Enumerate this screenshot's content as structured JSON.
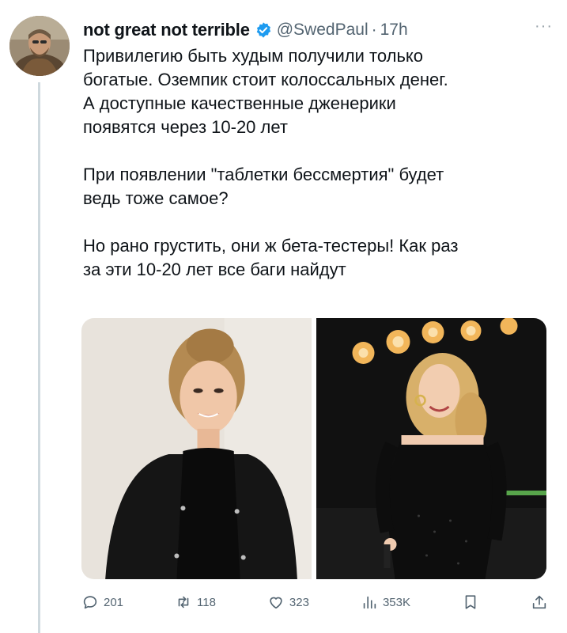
{
  "author": {
    "name": "not great not terrible",
    "handle": "@SwedPaul",
    "separator": "·",
    "time": "17h"
  },
  "more_label": "···",
  "tweet": {
    "paragraphs": [
      [
        "Привилегию быть худым получили только",
        "богатые. Оземпик стоит колоссальных денег.",
        "А доступные качественные дженерики",
        "появятся через 10-20 лет"
      ],
      [
        "При появлении \"таблетки бессмертия\" будет",
        "ведь тоже самое?"
      ],
      [
        "Но рано грустить, они ж бета-тестеры! Как раз",
        "за эти 10-20 лет все баги найдут"
      ]
    ]
  },
  "media": {
    "photos": [
      {
        "name": "photo-left-woman-black-jacket"
      },
      {
        "name": "photo-right-woman-on-stage"
      }
    ]
  },
  "actions": {
    "reply": {
      "icon": "reply-icon",
      "count": "201"
    },
    "retweet": {
      "icon": "retweet-icon",
      "count": "118"
    },
    "like": {
      "icon": "heart-icon",
      "count": "323"
    },
    "views": {
      "icon": "views-icon",
      "count": "353K"
    },
    "bookmark": {
      "icon": "bookmark-icon"
    },
    "share": {
      "icon": "share-icon"
    }
  },
  "colors": {
    "text": "#0f1419",
    "secondary": "#536471",
    "verified": "#1d9bf0",
    "thread_line": "#cfd9de"
  }
}
